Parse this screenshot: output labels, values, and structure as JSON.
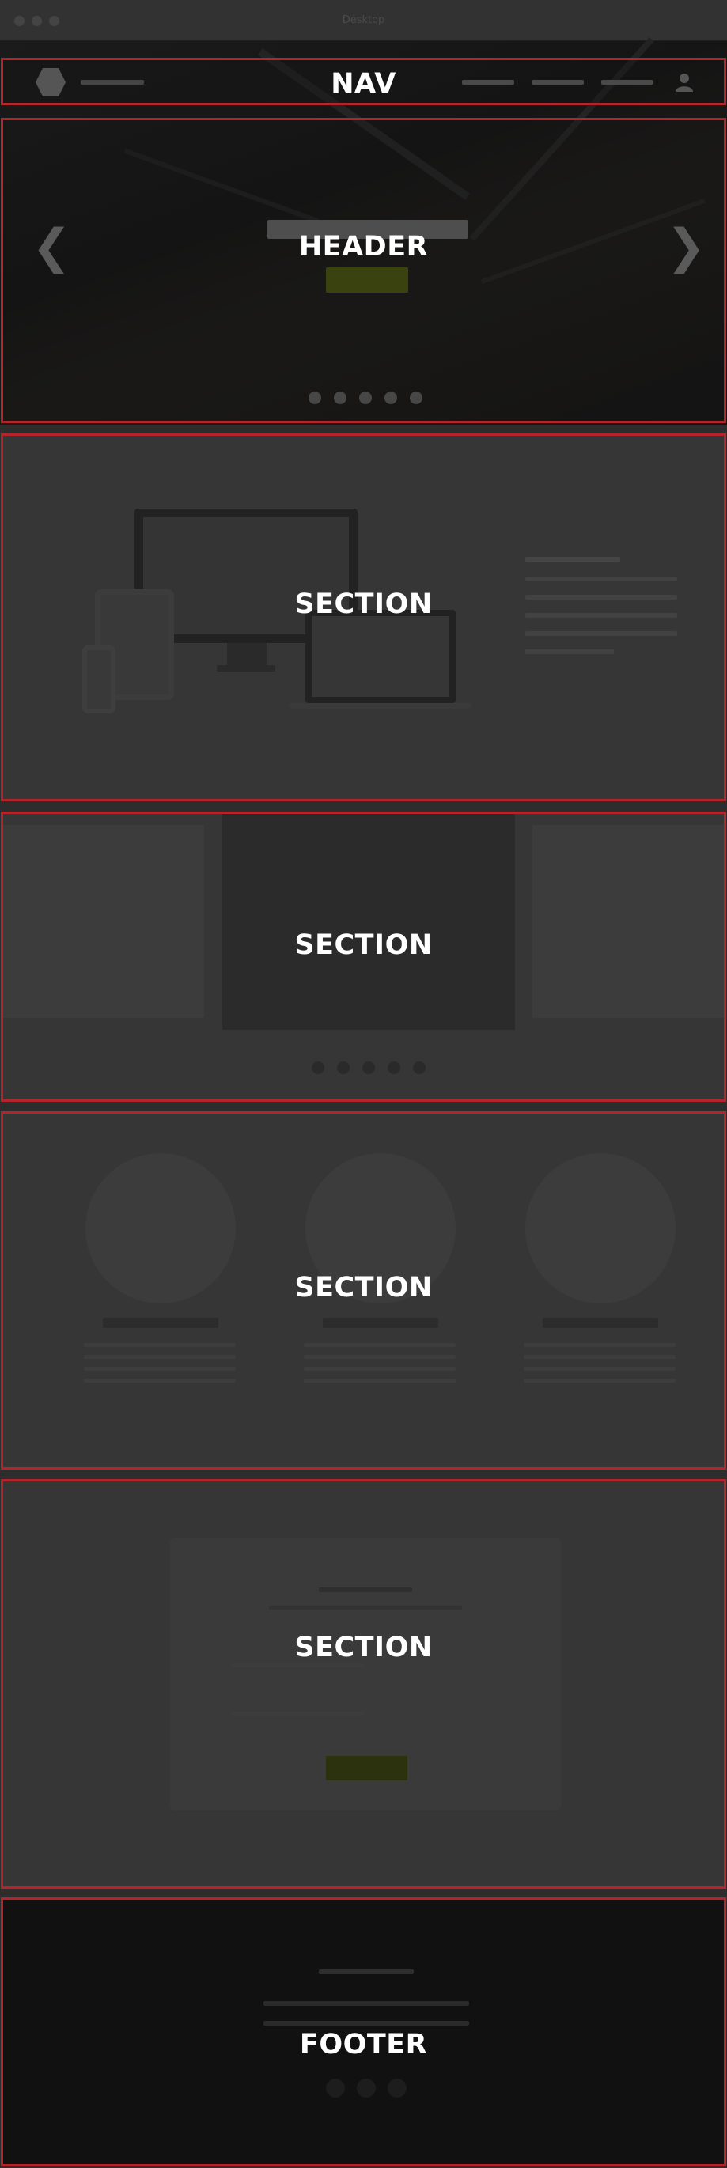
{
  "window": {
    "title": "Desktop"
  },
  "regions": {
    "nav": "NAV",
    "header": "HEADER",
    "section_features": "SECTION",
    "section_carousel": "SECTION",
    "section_team": "SECTION",
    "section_form": "SECTION",
    "footer": "FOOTER"
  },
  "icons": {
    "prev": "❮",
    "next": "❯"
  },
  "colors": {
    "outline": "#b3242b",
    "accent": "#4f5a11",
    "page": "#2d2d2d",
    "footer": "#111111"
  }
}
